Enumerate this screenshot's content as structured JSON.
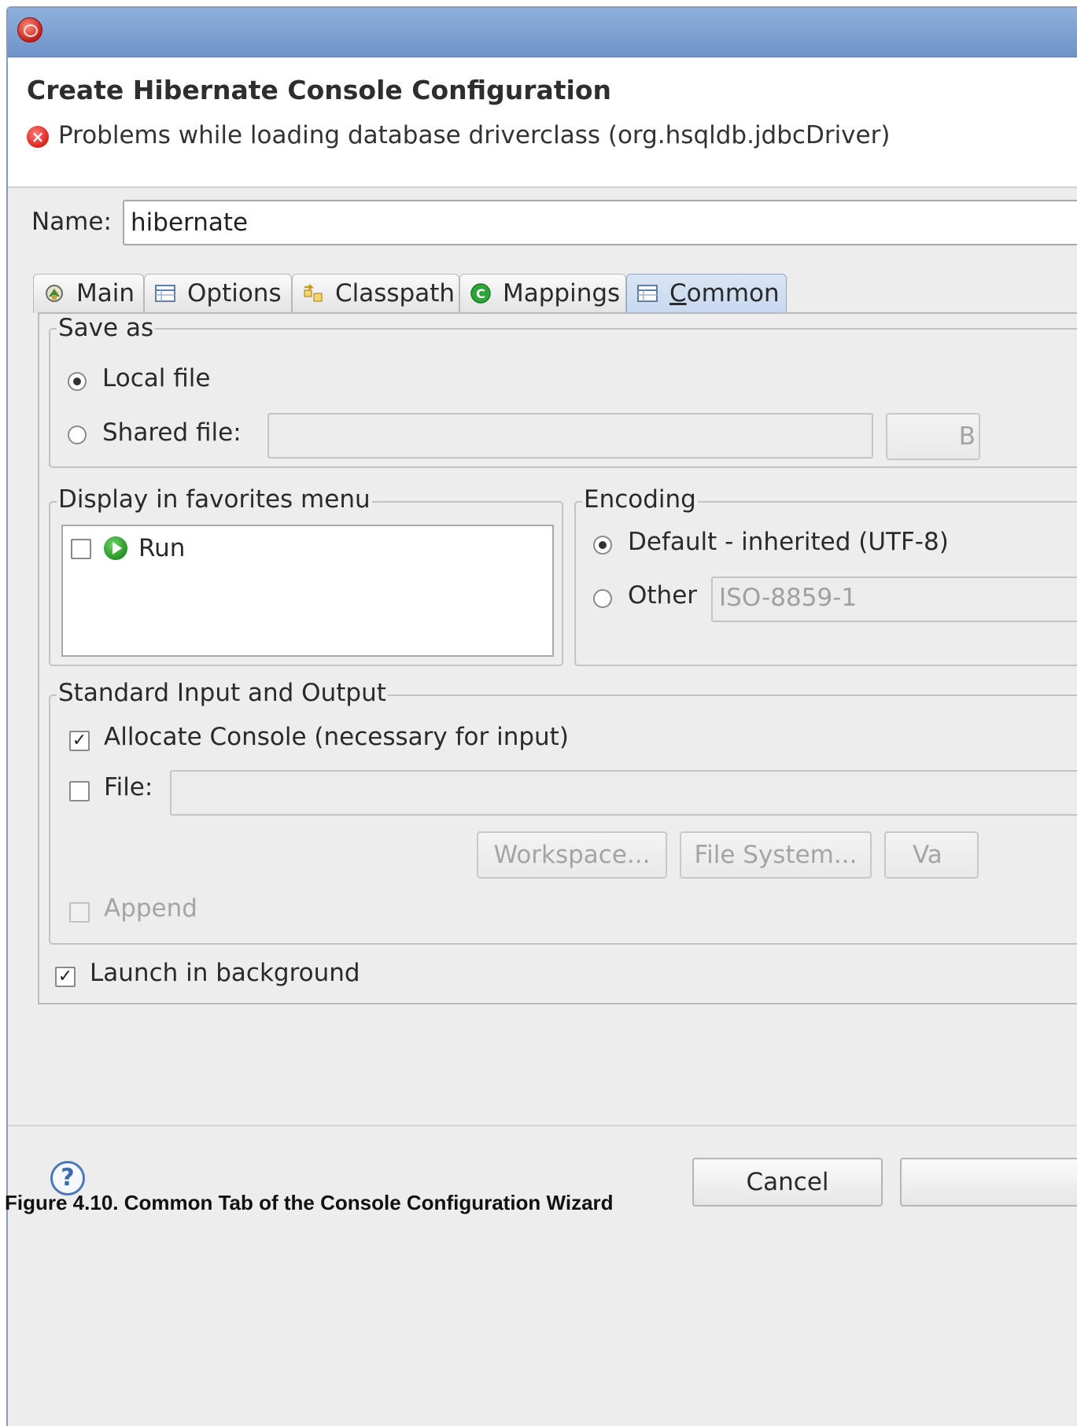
{
  "dialog": {
    "title": "Create Hibernate Console Configuration",
    "error_message": "Problems while loading database driverclass (org.hsqldb.jdbcDriver)"
  },
  "name_field": {
    "label": "Name:",
    "value": "hibernate"
  },
  "tabs": [
    {
      "label": "Main",
      "icon": "main-tab-icon"
    },
    {
      "label": "Options",
      "icon": "table-icon"
    },
    {
      "label": "Classpath",
      "icon": "classpath-icon"
    },
    {
      "label": "Mappings",
      "icon": "mappings-icon"
    },
    {
      "label": "Common",
      "icon": "table-icon",
      "active": true
    }
  ],
  "save_as": {
    "title": "Save as",
    "local_file": "Local file",
    "shared_file": "Shared file:",
    "shared_value": "",
    "browse_label": "B"
  },
  "favorites": {
    "title": "Display in favorites menu",
    "items": [
      {
        "label": "Run",
        "checked": false
      }
    ]
  },
  "encoding": {
    "title": "Encoding",
    "default_label": "Default - inherited (UTF-8)",
    "other_label": "Other",
    "other_value": "ISO-8859-1"
  },
  "std_io": {
    "title": "Standard Input and Output",
    "allocate_console": "Allocate Console (necessary for input)",
    "file_label": "File:",
    "file_value": "",
    "workspace_btn": "Workspace...",
    "filesystem_btn": "File System...",
    "variables_btn": "Va",
    "append_label": "Append"
  },
  "launch_background": "Launch in background",
  "footer": {
    "cancel": "Cancel"
  },
  "caption": "Figure 4.10. Common Tab of the Console Configuration Wizard"
}
